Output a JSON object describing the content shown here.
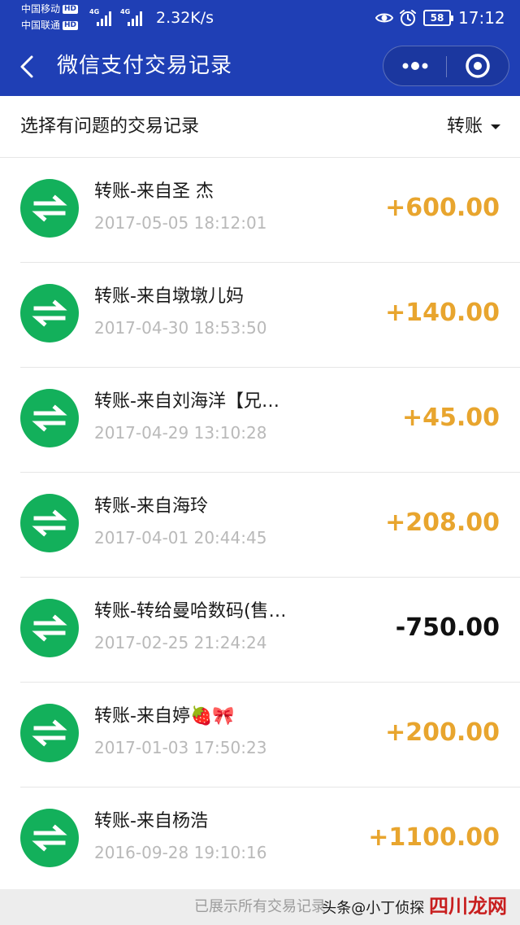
{
  "status_bar": {
    "carrier1": "中国移动",
    "carrier2": "中国联通",
    "hd_badge": "HD",
    "network_tag": "4G",
    "speed": "2.32K/s",
    "battery": "58",
    "time": "17:12",
    "icons": [
      "eye-icon",
      "alarm-clock-icon",
      "battery-icon"
    ]
  },
  "header": {
    "title": "微信支付交易记录",
    "back_icon": "chevron-left-icon",
    "more_icon": "more-dots-icon",
    "close_icon": "target-circle-icon"
  },
  "filter": {
    "label": "选择有问题的交易记录",
    "selected": "转账"
  },
  "records": [
    {
      "title": "转账-来自圣 杰",
      "time": "2017-05-05 18:12:01",
      "amount": "+600.00",
      "direction": "in"
    },
    {
      "title": "转账-来自墩墩儿妈",
      "time": "2017-04-30 18:53:50",
      "amount": "+140.00",
      "direction": "in"
    },
    {
      "title": "转账-来自刘海洋【兄…",
      "time": "2017-04-29 13:10:28",
      "amount": "+45.00",
      "direction": "in"
    },
    {
      "title": "转账-来自海玲",
      "time": "2017-04-01 20:44:45",
      "amount": "+208.00",
      "direction": "in"
    },
    {
      "title": "转账-转给曼哈数码(售…",
      "time": "2017-02-25 21:24:24",
      "amount": "-750.00",
      "direction": "out"
    },
    {
      "title": "转账-来自婷🍓🎀",
      "time": "2017-01-03 17:50:23",
      "amount": "+200.00",
      "direction": "in"
    },
    {
      "title": "转账-来自杨浩",
      "time": "2016-09-28 19:10:16",
      "amount": "+1100.00",
      "direction": "in"
    }
  ],
  "footer": {
    "text": "已展示所有交易记录"
  },
  "watermark": {
    "prefix": "头条@小丁侦探",
    "brand": "四川龙网"
  },
  "colors": {
    "header_bg": "#1f3fb5",
    "icon_green": "#13b05b",
    "income": "#e8a52e",
    "expense": "#111111",
    "time_gray": "#b9b9b9"
  }
}
